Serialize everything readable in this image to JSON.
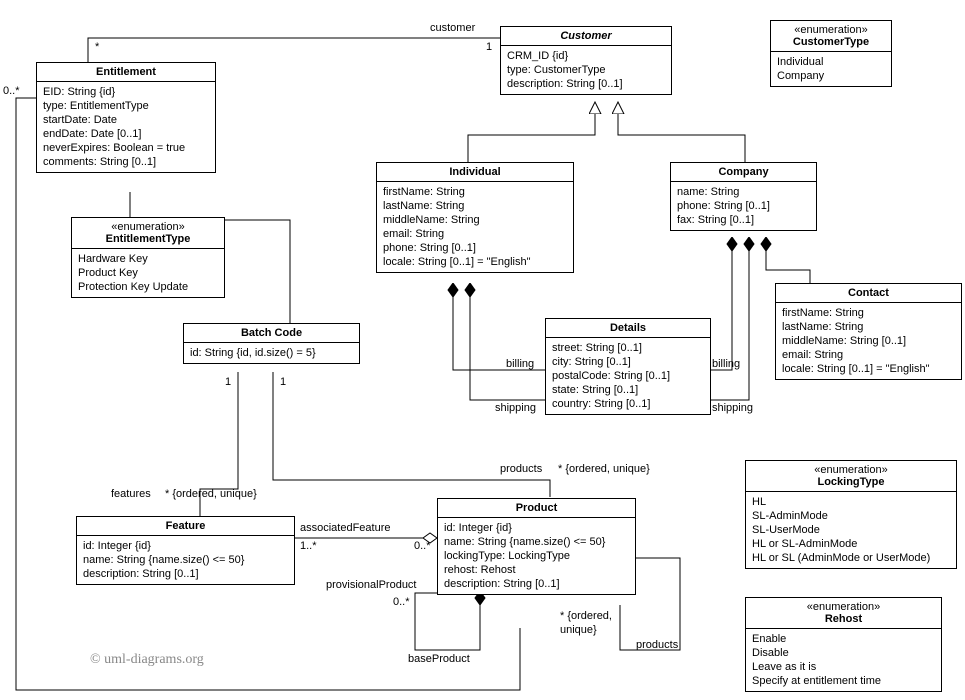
{
  "copyright": "© uml-diagrams.org",
  "labels": {
    "customer": "customer",
    "one_a": "1",
    "star_a": "*",
    "zero_star_a": "0..*",
    "one_b": "1",
    "one_c": "1",
    "features": "features",
    "star_ord_a": "* {ordered, unique}",
    "products": "products",
    "star_ord_b": "* {ordered, unique}",
    "associatedFeature": "associatedFeature",
    "one_plus": "1..*",
    "zero_star_b": "0..*",
    "provisionalProduct": "provisionalProduct",
    "zero_star_c": "0..*",
    "baseProduct": "baseProduct",
    "star_ord_c": "* {ordered,",
    "unique_c": "unique}",
    "products_b": "products",
    "billing_a": "billing",
    "shipping_a": "shipping",
    "billing_b": "billing",
    "shipping_b": "shipping"
  },
  "classes": {
    "Entitlement": {
      "name": "Entitlement",
      "attrs": [
        "EID: String {id}",
        "type: EntitlementType",
        "startDate: Date",
        "endDate: Date [0..1]",
        "neverExpires: Boolean = true",
        "comments: String [0..1]"
      ]
    },
    "EntitlementType": {
      "stereo": "«enumeration»",
      "name": "EntitlementType",
      "attrs": [
        "Hardware Key",
        "Product Key",
        "Protection Key Update"
      ]
    },
    "Customer": {
      "name": "Customer",
      "italic": true,
      "attrs": [
        "CRM_ID {id}",
        "type: CustomerType",
        "description: String [0..1]"
      ]
    },
    "CustomerType": {
      "stereo": "«enumeration»",
      "name": "CustomerType",
      "attrs": [
        "Individual",
        "Company"
      ]
    },
    "Individual": {
      "name": "Individual",
      "attrs": [
        "firstName: String",
        "lastName: String",
        "middleName: String",
        "email: String",
        "phone: String [0..1]",
        "locale: String [0..1] = \"English\""
      ]
    },
    "Company": {
      "name": "Company",
      "attrs": [
        "name: String",
        "phone: String [0..1]",
        "fax: String [0..1]"
      ]
    },
    "Details": {
      "name": "Details",
      "attrs": [
        "street: String [0..1]",
        "city: String [0..1]",
        "postalCode: String [0..1]",
        "state: String [0..1]",
        "country: String [0..1]"
      ]
    },
    "Contact": {
      "name": "Contact",
      "attrs": [
        "firstName: String",
        "lastName: String",
        "middleName: String [0..1]",
        "email: String",
        "locale: String [0..1] = \"English\""
      ]
    },
    "BatchCode": {
      "name": "Batch Code",
      "attrs": [
        "id: String {id, id.size() = 5}"
      ]
    },
    "Feature": {
      "name": "Feature",
      "attrs": [
        "id: Integer {id}",
        "name: String {name.size() <= 50}",
        "description: String [0..1]"
      ]
    },
    "Product": {
      "name": "Product",
      "attrs": [
        "id: Integer {id}",
        "name: String {name.size() <= 50}",
        "lockingType: LockingType",
        "rehost: Rehost",
        "description: String [0..1]"
      ]
    },
    "LockingType": {
      "stereo": "«enumeration»",
      "name": "LockingType",
      "attrs": [
        "HL",
        "SL-AdminMode",
        "SL-UserMode",
        "HL or SL-AdminMode",
        "HL or SL (AdminMode or UserMode)"
      ]
    },
    "Rehost": {
      "stereo": "«enumeration»",
      "name": "Rehost",
      "attrs": [
        "Enable",
        "Disable",
        "Leave as it is",
        "Specify at entitlement time"
      ]
    }
  }
}
